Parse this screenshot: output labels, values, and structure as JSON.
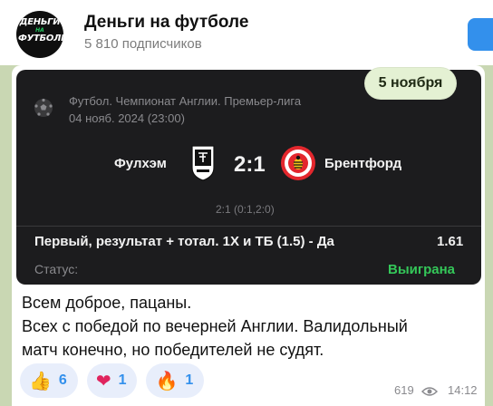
{
  "header": {
    "channel_title": "Деньги на футболе",
    "subscribers": "5 810 подписчиков",
    "avatar_line1": "ДЕНЬГИ",
    "avatar_line2": "НА",
    "avatar_line3": "ФУТБОЛЕ"
  },
  "date_badge": "5 ноября",
  "card": {
    "league": "Футбол. Чемпионат Англии. Премьер-лига",
    "match_date": "04 нояб. 2024 (23:00)",
    "home_team": "Фулхэм",
    "score": "2:1",
    "away_team": "Брентфорд",
    "half_scores": "2:1 (0:1,2:0)",
    "bet": "Первый, результат + тотал. 1Х и ТБ (1.5) - Да",
    "odds": "1.61",
    "status_label": "Статус:",
    "status_value": "Выиграна"
  },
  "message": {
    "line1": "Всем доброе, пацаны.",
    "line2": "Всех с победой по вечерней Англии. Валидольный",
    "line3": "матч конечно, но победителей не судят."
  },
  "reactions": [
    {
      "emoji": "👍",
      "icon": "thumbs-up-icon",
      "count": "6"
    },
    {
      "emoji": "❤",
      "icon": "heart-icon",
      "count": "1"
    },
    {
      "emoji": "🔥",
      "icon": "fire-icon",
      "count": "1"
    }
  ],
  "meta": {
    "views": "619",
    "time": "14:12"
  },
  "colors": {
    "accent": "#3390ec",
    "win": "#34c759",
    "card_bg": "#1c1c1e",
    "chat_bg": "#c9d7b3"
  }
}
